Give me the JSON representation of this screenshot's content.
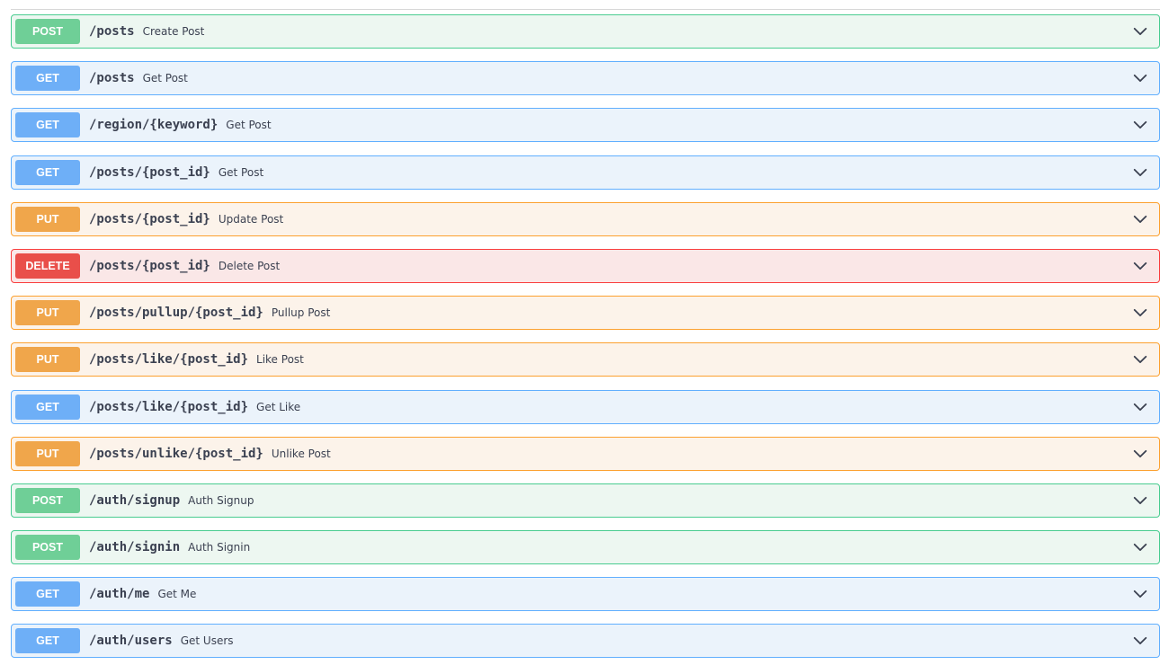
{
  "operations": [
    {
      "method": "POST",
      "path": "/posts",
      "summary": "Create Post",
      "kind": "post"
    },
    {
      "method": "GET",
      "path": "/posts",
      "summary": "Get Post",
      "kind": "get"
    },
    {
      "method": "GET",
      "path": "/region/{keyword}",
      "summary": "Get Post",
      "kind": "get"
    },
    {
      "method": "GET",
      "path": "/posts/{post_id}",
      "summary": "Get Post",
      "kind": "get"
    },
    {
      "method": "PUT",
      "path": "/posts/{post_id}",
      "summary": "Update Post",
      "kind": "put"
    },
    {
      "method": "DELETE",
      "path": "/posts/{post_id}",
      "summary": "Delete Post",
      "kind": "delete"
    },
    {
      "method": "PUT",
      "path": "/posts/pullup/{post_id}",
      "summary": "Pullup Post",
      "kind": "put"
    },
    {
      "method": "PUT",
      "path": "/posts/like/{post_id}",
      "summary": "Like Post",
      "kind": "put"
    },
    {
      "method": "GET",
      "path": "/posts/like/{post_id}",
      "summary": "Get Like",
      "kind": "get"
    },
    {
      "method": "PUT",
      "path": "/posts/unlike/{post_id}",
      "summary": "Unlike Post",
      "kind": "put"
    },
    {
      "method": "POST",
      "path": "/auth/signup",
      "summary": "Auth Signup",
      "kind": "post"
    },
    {
      "method": "POST",
      "path": "/auth/signin",
      "summary": "Auth Signin",
      "kind": "post"
    },
    {
      "method": "GET",
      "path": "/auth/me",
      "summary": "Get Me",
      "kind": "get"
    },
    {
      "method": "GET",
      "path": "/auth/users",
      "summary": "Get Users",
      "kind": "get"
    }
  ],
  "icons": {
    "expand": "chevron-down-icon"
  },
  "colors": {
    "post": "#49cc90",
    "get": "#61affe",
    "put": "#fca130",
    "delete": "#f93e3e",
    "text": "#3b4151"
  }
}
